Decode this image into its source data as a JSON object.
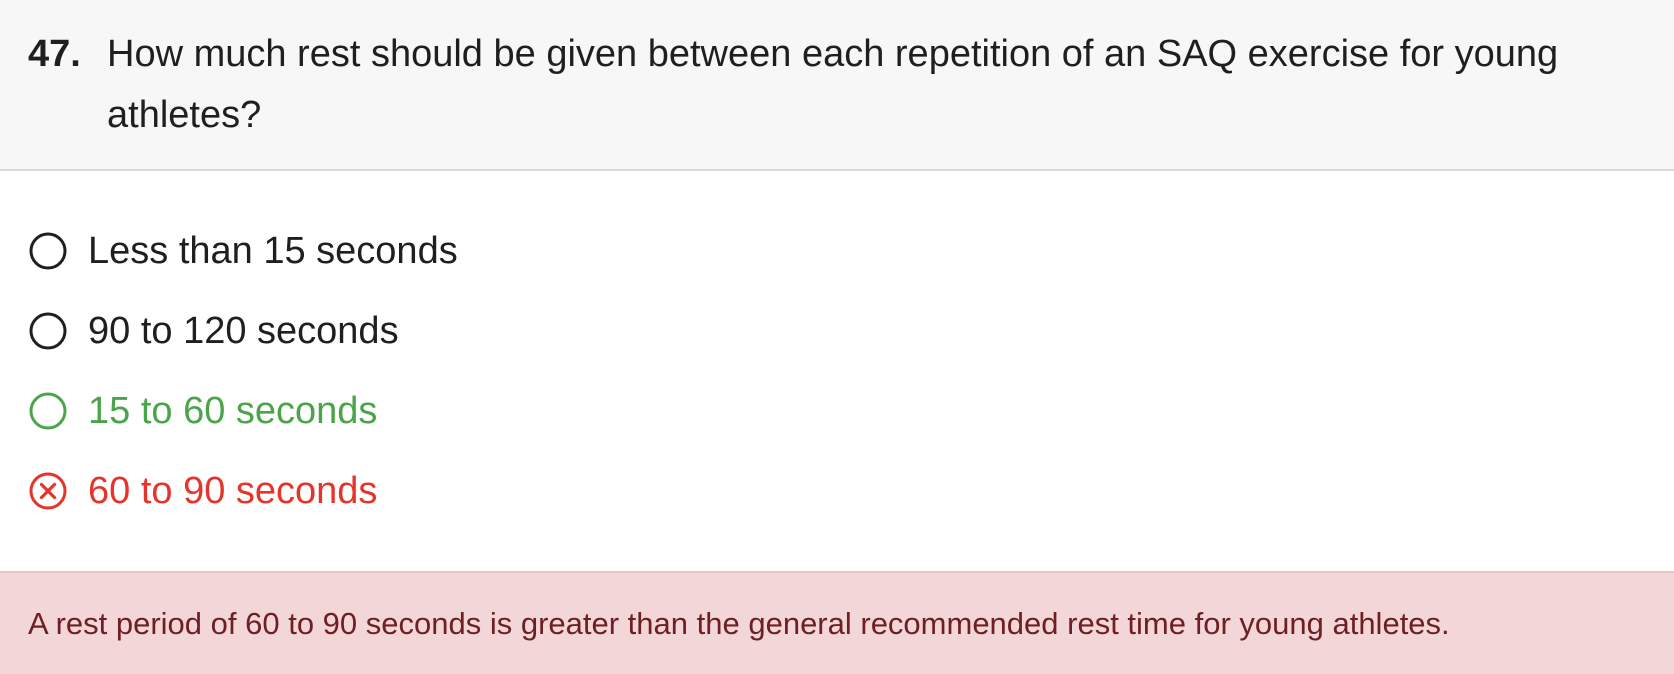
{
  "question": {
    "number": "47.",
    "text": "How much rest should be given between each repetition of an SAQ exercise for young athletes?"
  },
  "options": [
    {
      "label": "Less than 15 seconds",
      "state": "unselected"
    },
    {
      "label": "90 to 120 seconds",
      "state": "unselected"
    },
    {
      "label": "15 to 60 seconds",
      "state": "correct"
    },
    {
      "label": "60 to 90 seconds",
      "state": "selected-incorrect"
    }
  ],
  "feedback": {
    "text": "A rest period of 60 to 90 seconds is greater than the general recommended rest time for young athletes."
  },
  "colors": {
    "neutral": "#1f1f1f",
    "correct": "#4aa54a",
    "incorrect": "#e5352b",
    "header_bg": "#f7f7f7",
    "feedback_bg": "#f2d6d8",
    "feedback_text": "#6e1f24"
  },
  "icons": {
    "unselected": "radio-empty-icon",
    "correct": "radio-correct-icon",
    "selected-incorrect": "x-circle-icon"
  }
}
